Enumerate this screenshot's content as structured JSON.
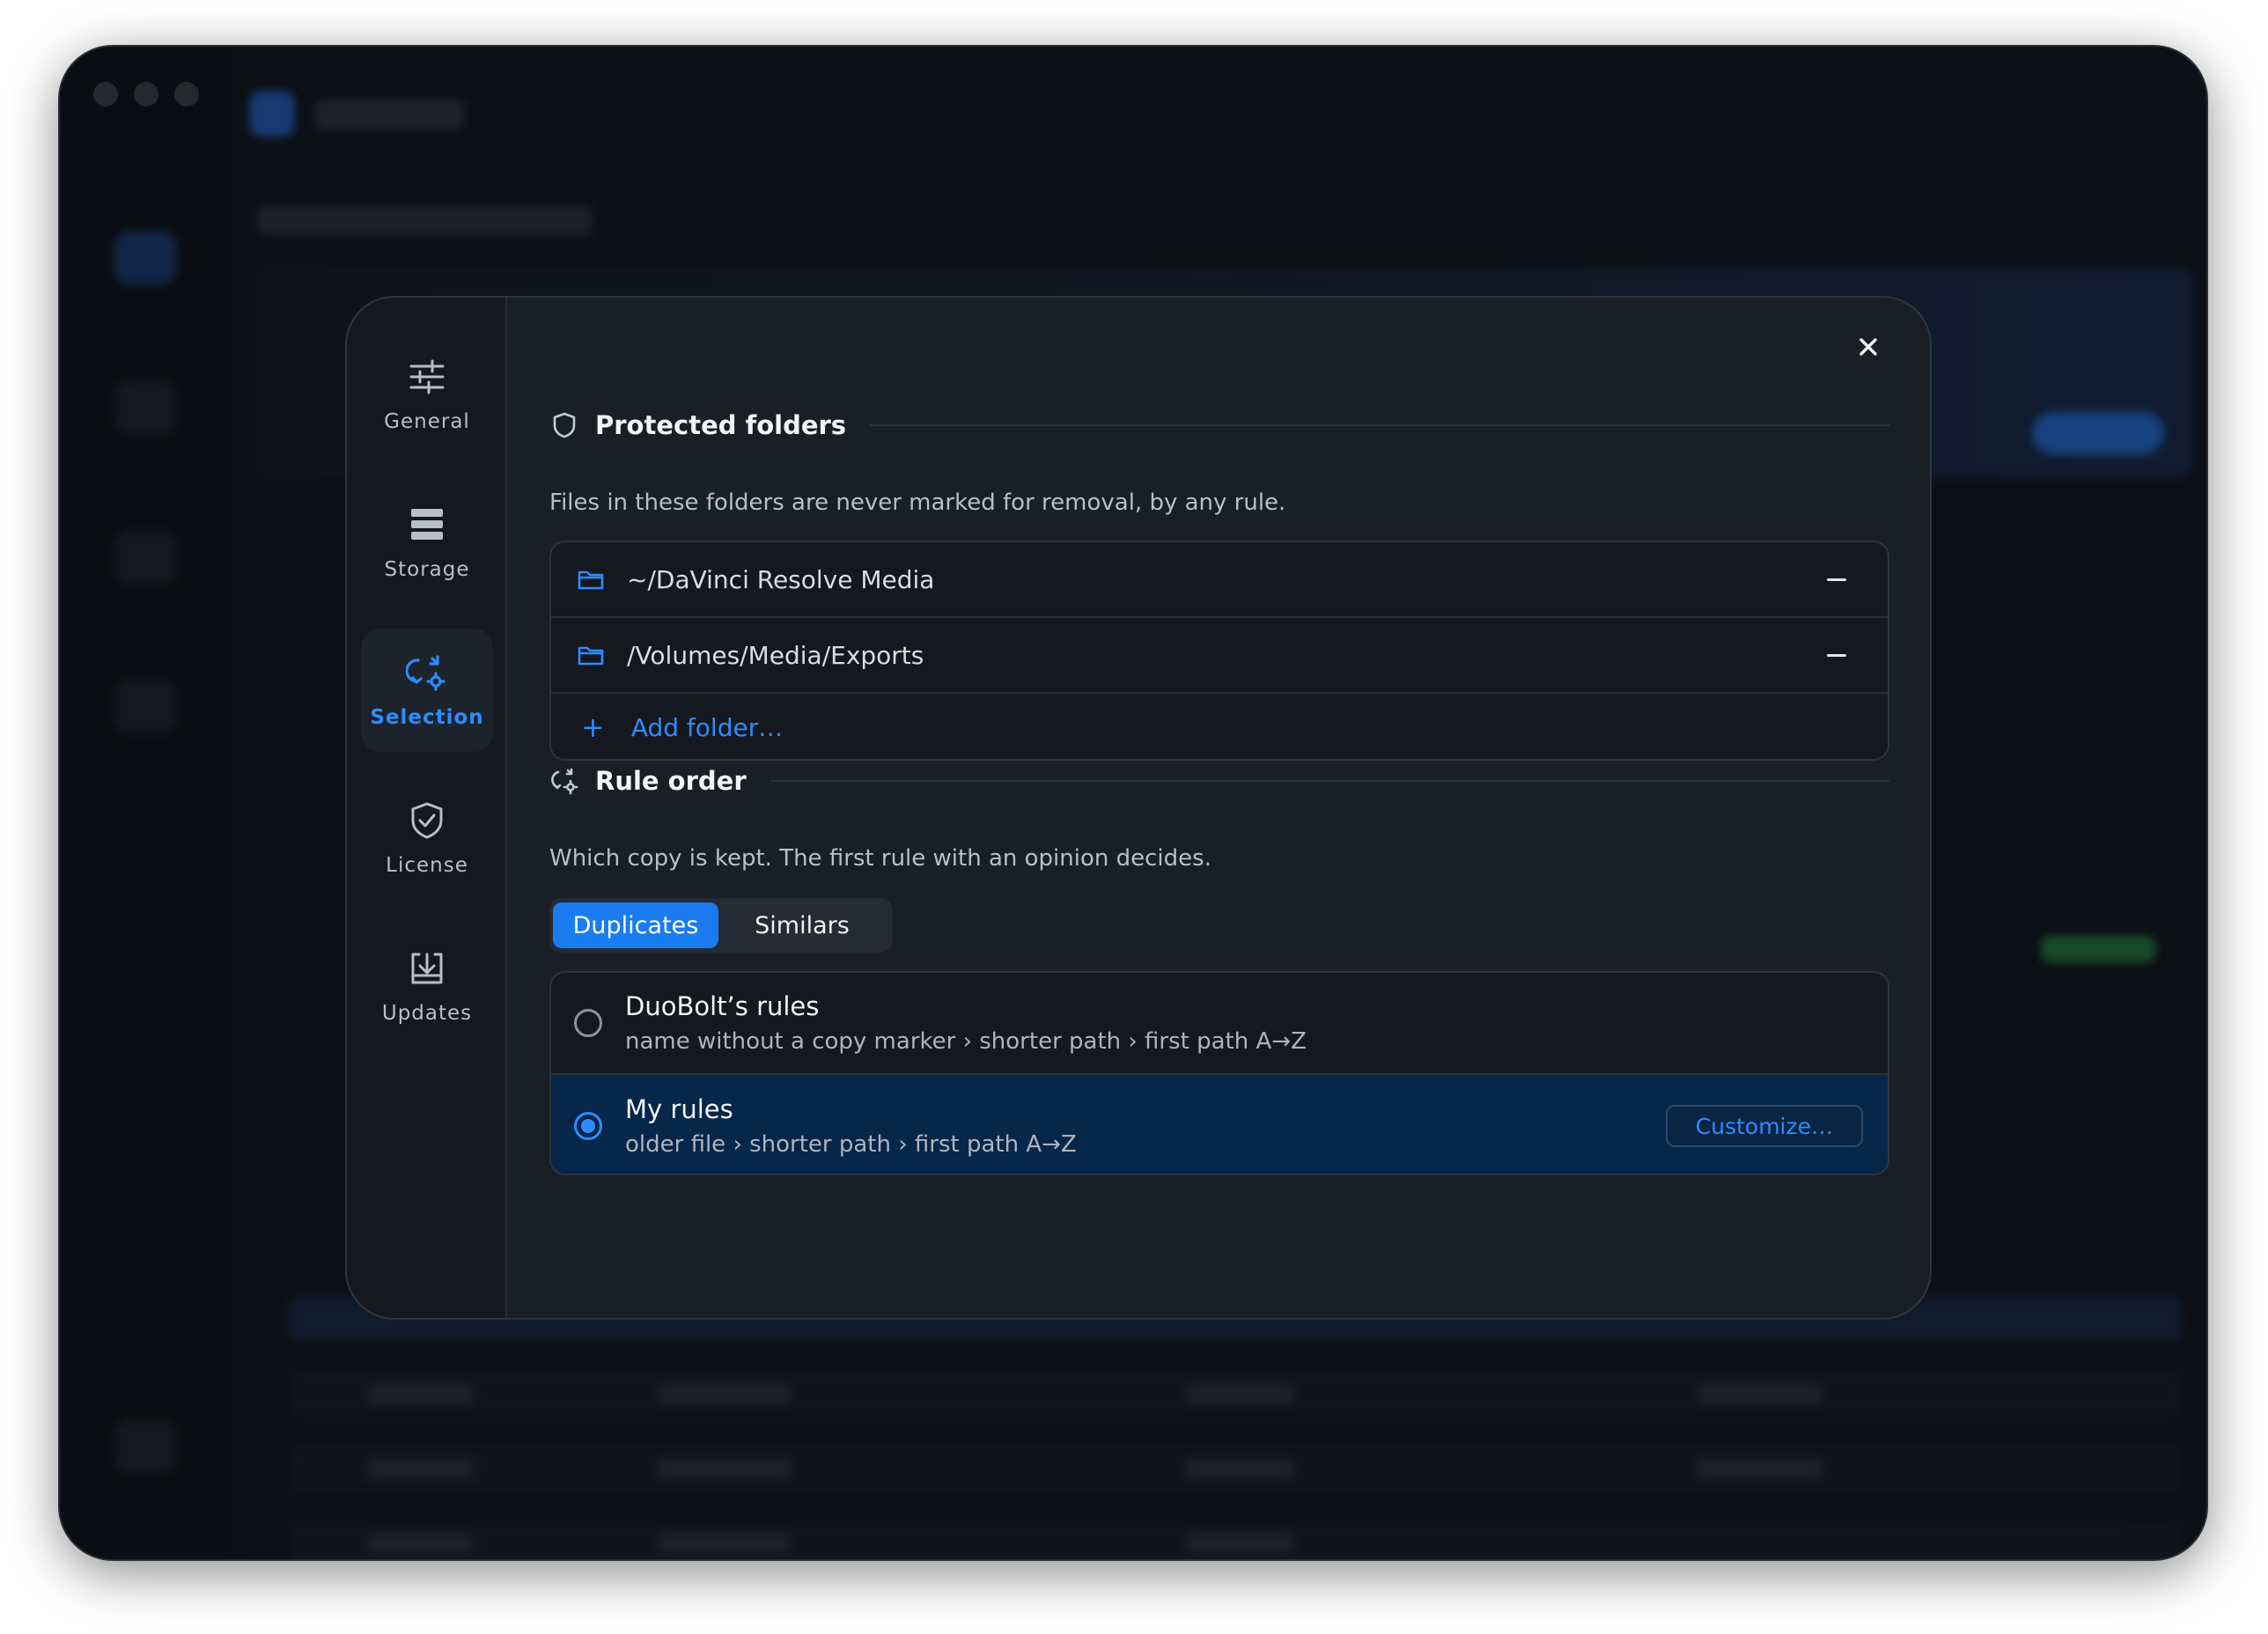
{
  "nav": {
    "items": [
      {
        "label": "General",
        "icon": "sliders-icon"
      },
      {
        "label": "Storage",
        "icon": "storage-icon"
      },
      {
        "label": "Selection",
        "icon": "selection-rules-icon"
      },
      {
        "label": "License",
        "icon": "shield-check-icon"
      },
      {
        "label": "Updates",
        "icon": "download-tray-icon"
      }
    ],
    "active": "Selection"
  },
  "protected": {
    "title": "Protected folders",
    "description": "Files in these folders are never marked for removal, by any rule.",
    "folders": [
      "~/DaVinci Resolve Media",
      "/Volumes/Media/Exports"
    ],
    "add_label": "Add folder…"
  },
  "rule_order": {
    "title": "Rule order",
    "description": "Which copy is kept. The first rule with an opinion decides.",
    "tabs": [
      "Duplicates",
      "Similars"
    ],
    "active_tab": "Duplicates",
    "options": [
      {
        "name": "DuoBolt’s rules",
        "detail": "name without a copy marker › shorter path › first path A→Z",
        "selected": false
      },
      {
        "name": "My rules",
        "detail": "older file › shorter path › first path A→Z",
        "selected": true
      }
    ],
    "customize_label": "Customize…"
  },
  "colors": {
    "accent": "#2d8cff",
    "modal_bg": "#1a1e26",
    "selected_row": "#06264a"
  }
}
